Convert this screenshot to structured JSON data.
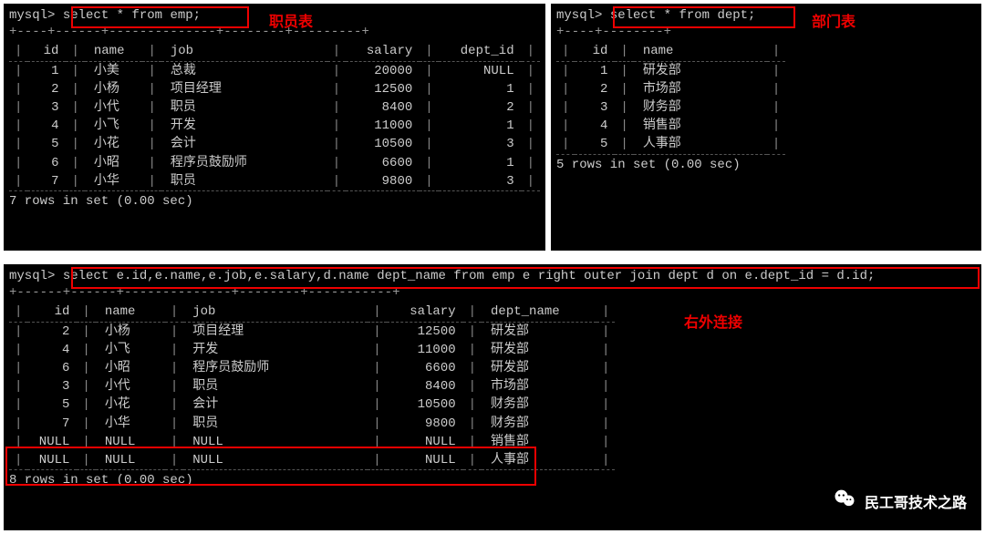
{
  "top_left": {
    "prompt": "mysql>",
    "sql": "select * from emp;",
    "label": "职员表",
    "headers": {
      "id": "id",
      "name": "name",
      "job": "job",
      "salary": "salary",
      "dept_id": "dept_id"
    },
    "rows": [
      {
        "id": "1",
        "name": "小美",
        "job": "总裁",
        "salary": "20000",
        "dept_id": "NULL"
      },
      {
        "id": "2",
        "name": "小杨",
        "job": "项目经理",
        "salary": "12500",
        "dept_id": "1"
      },
      {
        "id": "3",
        "name": "小代",
        "job": "职员",
        "salary": "8400",
        "dept_id": "2"
      },
      {
        "id": "4",
        "name": "小飞",
        "job": "开发",
        "salary": "11000",
        "dept_id": "1"
      },
      {
        "id": "5",
        "name": "小花",
        "job": "会计",
        "salary": "10500",
        "dept_id": "3"
      },
      {
        "id": "6",
        "name": "小昭",
        "job": "程序员鼓励师",
        "salary": "6600",
        "dept_id": "1"
      },
      {
        "id": "7",
        "name": "小华",
        "job": "职员",
        "salary": "9800",
        "dept_id": "3"
      }
    ],
    "footer": "7 rows in set (0.00 sec)"
  },
  "top_right": {
    "prompt": "mysql>",
    "sql": "select * from dept;",
    "label": "部门表",
    "headers": {
      "id": "id",
      "name": "name"
    },
    "rows": [
      {
        "id": "1",
        "name": "研发部"
      },
      {
        "id": "2",
        "name": "市场部"
      },
      {
        "id": "3",
        "name": "财务部"
      },
      {
        "id": "4",
        "name": "销售部"
      },
      {
        "id": "5",
        "name": "人事部"
      }
    ],
    "footer": "5 rows in set (0.00 sec)"
  },
  "bottom": {
    "prompt": "mysql>",
    "sql": "select e.id,e.name,e.job,e.salary,d.name dept_name from emp e right outer join dept d on e.dept_id = d.id;",
    "label": "右外连接",
    "headers": {
      "id": "id",
      "name": "name",
      "job": "job",
      "salary": "salary",
      "dept_name": "dept_name"
    },
    "rows": [
      {
        "id": "2",
        "name": "小杨",
        "job": "项目经理",
        "salary": "12500",
        "dept_name": "研发部"
      },
      {
        "id": "4",
        "name": "小飞",
        "job": "开发",
        "salary": "11000",
        "dept_name": "研发部"
      },
      {
        "id": "6",
        "name": "小昭",
        "job": "程序员鼓励师",
        "salary": "6600",
        "dept_name": "研发部"
      },
      {
        "id": "3",
        "name": "小代",
        "job": "职员",
        "salary": "8400",
        "dept_name": "市场部"
      },
      {
        "id": "5",
        "name": "小花",
        "job": "会计",
        "salary": "10500",
        "dept_name": "财务部"
      },
      {
        "id": "7",
        "name": "小华",
        "job": "职员",
        "salary": "9800",
        "dept_name": "财务部"
      },
      {
        "id": "NULL",
        "name": "NULL",
        "job": "NULL",
        "salary": "NULL",
        "dept_name": "销售部"
      },
      {
        "id": "NULL",
        "name": "NULL",
        "job": "NULL",
        "salary": "NULL",
        "dept_name": "人事部"
      }
    ],
    "footer": "8 rows in set (0.00 sec)"
  },
  "watermark": "民工哥技术之路"
}
